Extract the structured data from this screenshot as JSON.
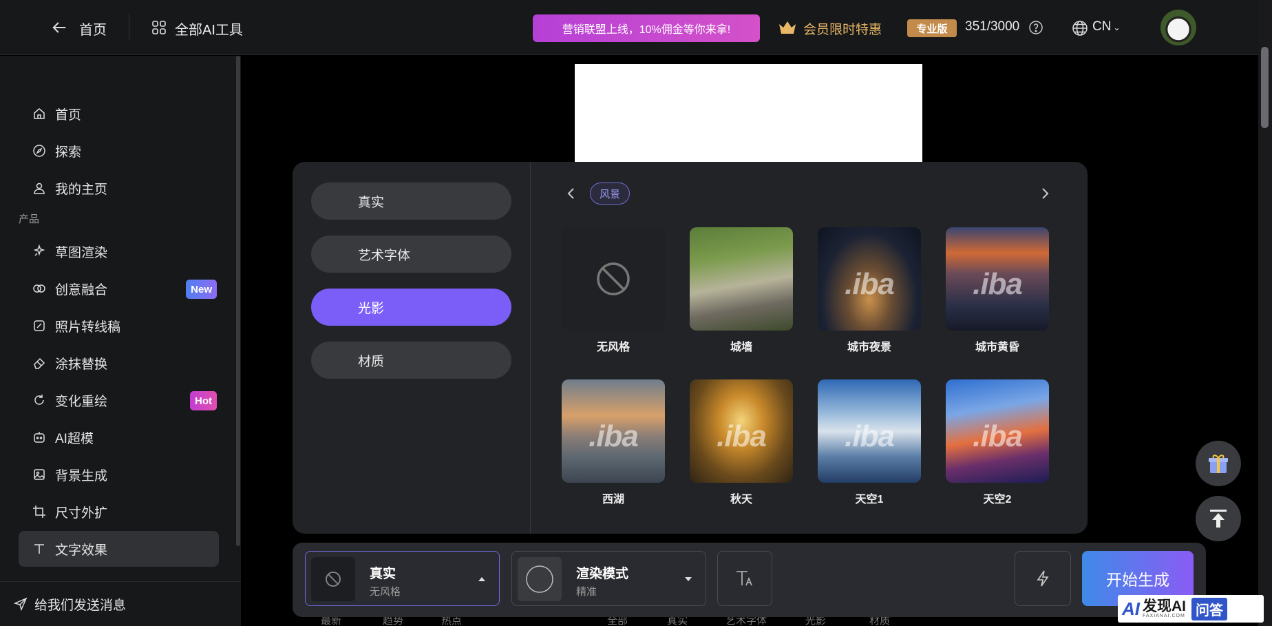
{
  "topbar": {
    "home_label": "首页",
    "tools_label": "全部AI工具",
    "promo": "营销联盟上线，10%佣金等你来拿!",
    "member": "会员限时特惠",
    "plan_badge": "专业版",
    "credits": "351/3000",
    "language": "CN"
  },
  "sidebar": {
    "top_items": [
      "首页",
      "探索",
      "我的主页"
    ],
    "section_label": "产品",
    "products": [
      {
        "label": "草图渲染",
        "tag": ""
      },
      {
        "label": "创意融合",
        "tag": "New"
      },
      {
        "label": "照片转线稿",
        "tag": ""
      },
      {
        "label": "涂抹替换",
        "tag": ""
      },
      {
        "label": "变化重绘",
        "tag": "Hot"
      },
      {
        "label": "AI超模",
        "tag": ""
      },
      {
        "label": "背景生成",
        "tag": ""
      },
      {
        "label": "尺寸外扩",
        "tag": ""
      },
      {
        "label": "文字效果",
        "tag": ""
      }
    ],
    "feedback": "给我们发送消息"
  },
  "style_panel": {
    "categories": [
      "真实",
      "艺术字体",
      "光影",
      "材质"
    ],
    "active_category": "光影",
    "filter_chip": "风景",
    "styles": [
      "无风格",
      "城墙",
      "城市夜景",
      "城市黄昏",
      "西湖",
      "秋天",
      "天空1",
      "天空2"
    ],
    "watermark_text": ".iba"
  },
  "bottombar": {
    "style_title": "真实",
    "style_sub": "无风格",
    "mode_title": "渲染模式",
    "mode_sub": "精准",
    "generate": "开始生成"
  },
  "peek_tabs": [
    "最新",
    "趋势",
    "热点",
    "全部",
    "真实",
    "艺术字体",
    "光影",
    "材质"
  ],
  "watermark": {
    "logo": "AI",
    "title": "发现AI",
    "site": "FAXIANAI.COM",
    "badge": "问答"
  },
  "colors": {
    "accent": "#7b5ef7",
    "promo": "#c84ad2",
    "gold": "#e8b866"
  }
}
